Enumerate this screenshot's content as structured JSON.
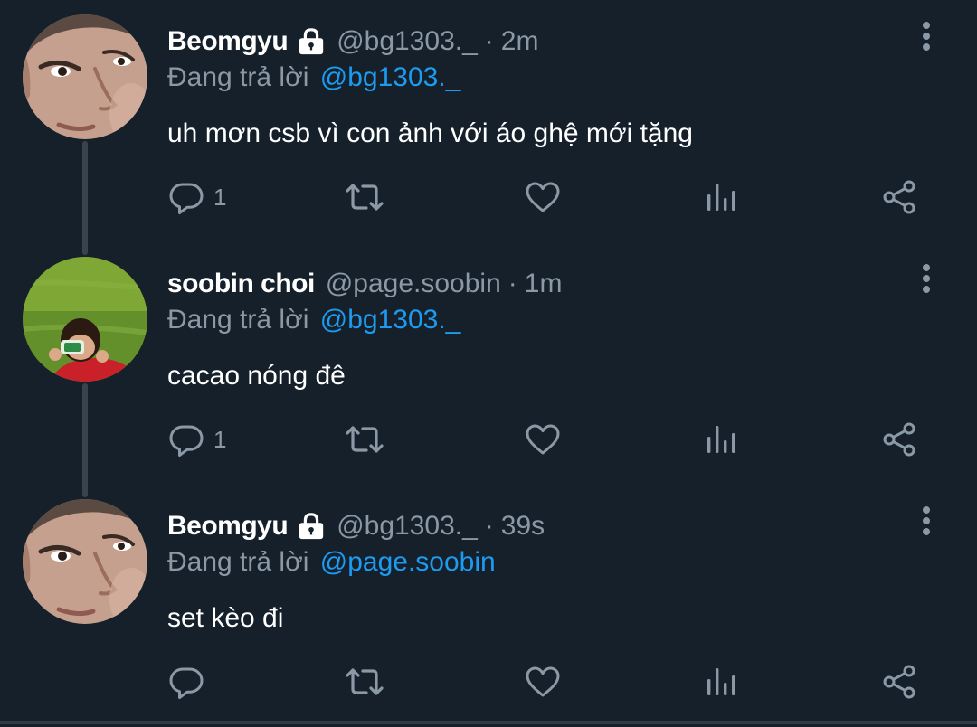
{
  "colors": {
    "background": "#15202b",
    "primary_text": "#ffffff",
    "secondary_text": "#8b98a5",
    "link": "#1d9bf0",
    "thread_line": "#38444d"
  },
  "tweets": [
    {
      "name": "Beomgyu",
      "protected": true,
      "handle": "@bg1303._",
      "dot": "·",
      "time": "2m",
      "reply_prefix": "Đang trả lời",
      "reply_to": "@bg1303._",
      "text": "uh mơn csb vì con ảnh với áo ghệ mới tặng",
      "reply_count": "1",
      "icons": [
        "reply-icon",
        "retweet-icon",
        "like-icon",
        "analytics-icon",
        "share-icon",
        "more-icon"
      ]
    },
    {
      "name": "soobin choi",
      "protected": false,
      "handle": "@page.soobin",
      "dot": "·",
      "time": "1m",
      "reply_prefix": "Đang trả lời",
      "reply_to": "@bg1303._",
      "text": "cacao nóng đê",
      "reply_count": "1",
      "icons": [
        "reply-icon",
        "retweet-icon",
        "like-icon",
        "analytics-icon",
        "share-icon",
        "more-icon"
      ]
    },
    {
      "name": "Beomgyu",
      "protected": true,
      "handle": "@bg1303._",
      "dot": "·",
      "time": "39s",
      "reply_prefix": "Đang trả lời",
      "reply_to": "@page.soobin",
      "text": "set kèo đi",
      "reply_count": "",
      "icons": [
        "reply-icon",
        "retweet-icon",
        "like-icon",
        "analytics-icon",
        "share-icon",
        "more-icon"
      ]
    }
  ]
}
